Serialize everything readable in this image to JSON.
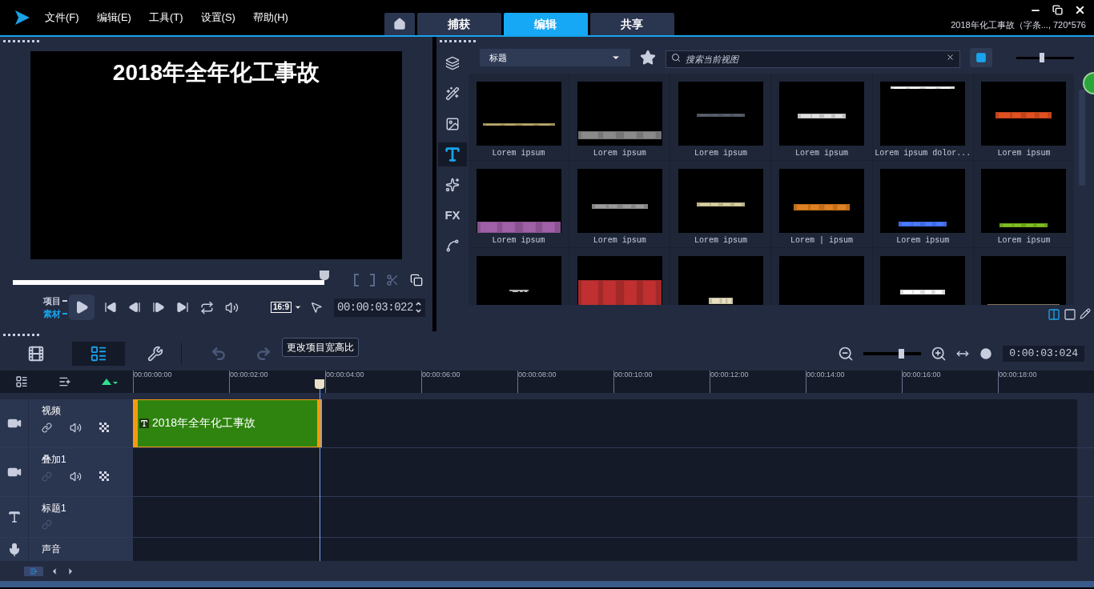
{
  "app_menu": [
    "文件(F)",
    "编辑(E)",
    "工具(T)",
    "设置(S)",
    "帮助(H)"
  ],
  "mode_tabs": [
    {
      "kind": "home",
      "selected": false
    },
    {
      "kind": "text",
      "label": "捕获",
      "selected": false
    },
    {
      "kind": "text",
      "label": "编辑",
      "selected": true
    },
    {
      "kind": "text",
      "label": "共享",
      "selected": false
    }
  ],
  "project_info": "2018年化工事故（字条..., 720*576",
  "preview": {
    "title_text": "2018年全年化工事故",
    "scrubber": {
      "level": 0.8
    },
    "mode_labels": [
      {
        "label": "项目",
        "selected": false
      },
      {
        "label": "素材",
        "selected": true
      }
    ],
    "aspect_ratio": "16:9",
    "timecode": "00:00:03:022",
    "tooltip": "更改项目宽高比"
  },
  "library": {
    "categories": [
      {
        "kind": "media",
        "selected": false
      },
      {
        "kind": "instant",
        "selected": false
      },
      {
        "kind": "transition",
        "selected": false
      },
      {
        "kind": "title",
        "selected": true
      },
      {
        "kind": "graphics",
        "selected": false
      },
      {
        "kind": "text",
        "label": "FX",
        "selected": false
      },
      {
        "kind": "path",
        "selected": false
      }
    ],
    "category_dropdown": "标题",
    "search": {
      "placeholder": "搜索当前视图"
    },
    "thumb_size": {
      "level": 0.45
    },
    "items": [
      {
        "kind": "picture",
        "label": "Lorem ipsum"
      },
      {
        "kind": "picture",
        "label": "Lorem ipsum"
      },
      {
        "kind": "picture",
        "label": "Lorem ipsum"
      },
      {
        "kind": "picture",
        "label": "Lorem ipsum"
      },
      {
        "kind": "picture",
        "label": "Lorem ipsum dolor..."
      },
      {
        "kind": "picture",
        "label": "Lorem ipsum"
      },
      {
        "kind": "picture",
        "label": "Lorem ipsum"
      },
      {
        "kind": "picture",
        "label": "Lorem ipsum"
      },
      {
        "kind": "picture",
        "label": "Lorem ipsum"
      },
      {
        "kind": "picture",
        "label": "Lorem | ipsum"
      },
      {
        "kind": "picture",
        "label": "Lorem ipsum"
      },
      {
        "kind": "picture",
        "label": "Lorem ipsum"
      },
      {
        "kind": "picture"
      },
      {
        "kind": "picture"
      },
      {
        "kind": "picture"
      },
      {
        "kind": "picture"
      },
      {
        "kind": "picture"
      },
      {
        "kind": "picture"
      }
    ]
  },
  "timeline": {
    "view_buttons": [
      {
        "selected": false
      },
      {
        "selected": true
      }
    ],
    "history": [
      {
        "kind": "undo",
        "disabled": true
      },
      {
        "kind": "redo",
        "disabled": true
      }
    ],
    "zoom": {
      "level": 0.65
    },
    "timecode": "0:00:03:024",
    "ruler": [
      "00:00:00:00",
      "00:00:02:00",
      "00:00:04:00",
      "00:00:06:00",
      "00:00:08:00",
      "00:00:10:00",
      "00:00:12:00",
      "00:00:14:00",
      "00:00:16:00",
      "00:00:18:00"
    ],
    "tracks": [
      {
        "kind": "video",
        "name": "视频",
        "link_enabled": true,
        "clips": [
          {
            "label": "2018年全年化工事故",
            "selected": true
          }
        ]
      },
      {
        "kind": "overlay",
        "name": "叠加1",
        "link_enabled": false
      },
      {
        "kind": "title",
        "name": "标题1",
        "link_enabled": false
      },
      {
        "kind": "audio",
        "name": "声音"
      }
    ]
  }
}
